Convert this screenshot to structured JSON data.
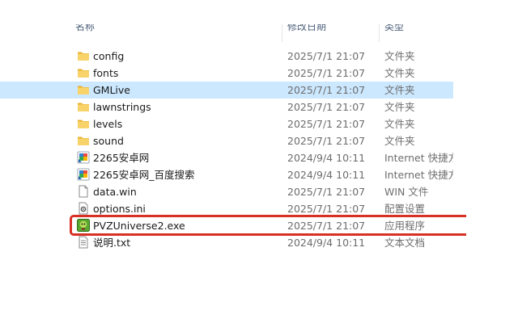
{
  "header": {
    "name_col": "名称",
    "date_col": "修改日期",
    "type_col": "类型"
  },
  "files": [
    {
      "name": "config",
      "date": "2025/7/1 21:07",
      "type": "文件夹",
      "icon": "folder-icon"
    },
    {
      "name": "fonts",
      "date": "2025/7/1 21:07",
      "type": "文件夹",
      "icon": "folder-icon"
    },
    {
      "name": "GMLive",
      "date": "2025/7/1 21:07",
      "type": "文件夹",
      "icon": "folder-icon",
      "selected": true
    },
    {
      "name": "lawnstrings",
      "date": "2025/7/1 21:07",
      "type": "文件夹",
      "icon": "folder-icon"
    },
    {
      "name": "levels",
      "date": "2025/7/1 21:07",
      "type": "文件夹",
      "icon": "folder-icon"
    },
    {
      "name": "sound",
      "date": "2025/7/1 21:07",
      "type": "文件夹",
      "icon": "folder-icon"
    },
    {
      "name": "2265安卓网",
      "date": "2024/9/4 10:11",
      "type": "Internet 快捷方",
      "icon": "internet-shortcut-icon"
    },
    {
      "name": "2265安卓网_百度搜索",
      "date": "2024/9/4 10:11",
      "type": "Internet 快捷方",
      "icon": "internet-shortcut-icon"
    },
    {
      "name": "data.win",
      "date": "2025/7/1 21:07",
      "type": "WIN 文件",
      "icon": "file-icon"
    },
    {
      "name": "options.ini",
      "date": "2025/7/1 21:07",
      "type": "配置设置",
      "icon": "settings-file-icon"
    },
    {
      "name": "PVZUniverse2.exe",
      "date": "2025/7/1 21:07",
      "type": "应用程序",
      "icon": "pvz-app-icon"
    },
    {
      "name": "说明.txt",
      "date": "2024/9/4 10:11",
      "type": "文本文档",
      "icon": "text-file-icon"
    }
  ],
  "colors": {
    "highlight_border": "#d93025",
    "folder": "#f6c546",
    "selected_row": "#cce8ff"
  }
}
